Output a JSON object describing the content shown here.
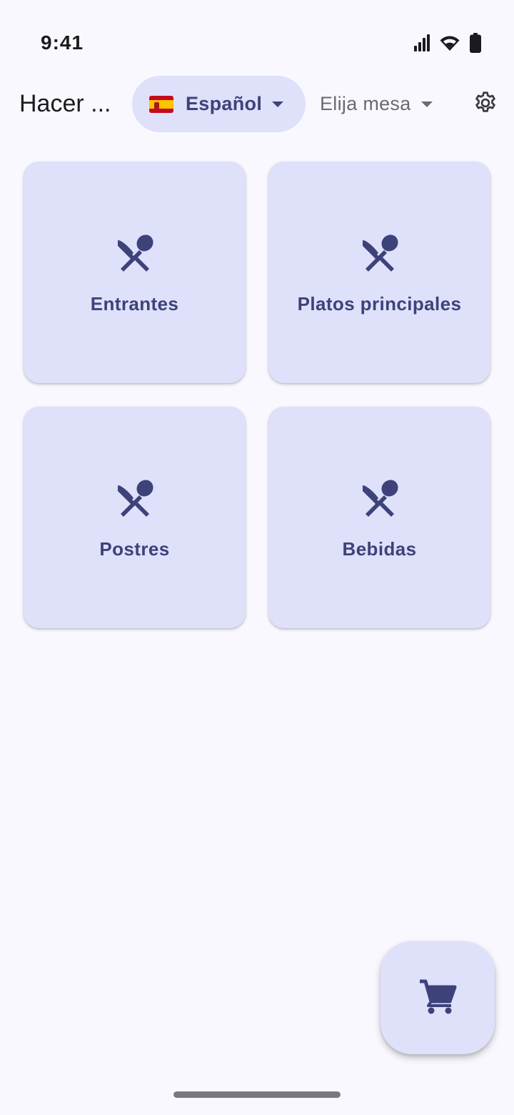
{
  "status_bar": {
    "time": "9:41",
    "icons": [
      "signal-icon",
      "wifi-icon",
      "battery-icon"
    ]
  },
  "app_bar": {
    "title": "Hacer ...",
    "language": {
      "label": "Español",
      "flag": "spain-flag-icon"
    },
    "table_select": {
      "label": "Elija mesa"
    },
    "settings_icon": "gear-icon"
  },
  "categories": [
    {
      "label": "Entrantes",
      "icon": "restaurant-icon"
    },
    {
      "label": "Platos principales",
      "icon": "restaurant-icon"
    },
    {
      "label": "Postres",
      "icon": "restaurant-icon"
    },
    {
      "label": "Bebidas",
      "icon": "restaurant-icon"
    }
  ],
  "fab": {
    "icon": "cart-icon"
  },
  "colors": {
    "background": "#f9f8fe",
    "container": "#dfe0fa",
    "on_container": "#3d4379"
  }
}
